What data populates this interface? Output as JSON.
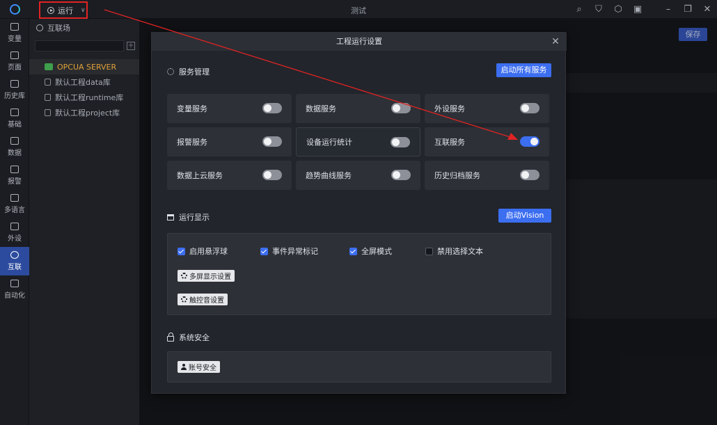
{
  "titlebar": {
    "run_label": "运行",
    "window_title": "测试",
    "icons": [
      "search-icon",
      "shield-icon",
      "package-icon",
      "save-icon",
      "minimize-icon",
      "restore-icon",
      "close-icon"
    ]
  },
  "nav": {
    "items": [
      {
        "label": "变量",
        "icon": "variable-icon"
      },
      {
        "label": "页面",
        "icon": "page-icon"
      },
      {
        "label": "历史库",
        "icon": "history-icon"
      },
      {
        "label": "基础",
        "icon": "basic-icon"
      },
      {
        "label": "数据",
        "icon": "data-icon"
      },
      {
        "label": "报警",
        "icon": "alarm-icon"
      },
      {
        "label": "多语言",
        "icon": "language-icon"
      },
      {
        "label": "外设",
        "icon": "device-icon"
      },
      {
        "label": "互联",
        "icon": "interconnect-icon",
        "active": true
      },
      {
        "label": "自动化",
        "icon": "automation-icon"
      }
    ]
  },
  "sidepanel": {
    "header": "互联场",
    "tree": [
      {
        "label": "OPCUA SERVER",
        "selected": true
      },
      {
        "label": "默认工程data库"
      },
      {
        "label": "默认工程runtime库"
      },
      {
        "label": "默认工程project库"
      }
    ]
  },
  "main": {
    "save_label": "保存"
  },
  "dialog": {
    "title": "工程运行设置",
    "service_section": {
      "title": "服务管理",
      "start_all_label": "启动所有服务",
      "services": [
        {
          "label": "变量服务",
          "on": false
        },
        {
          "label": "数据服务",
          "on": false
        },
        {
          "label": "外设服务",
          "on": false
        },
        {
          "label": "报警服务",
          "on": false
        },
        {
          "label": "设备运行统计",
          "on": false
        },
        {
          "label": "互联服务",
          "on": true
        },
        {
          "label": "数据上云服务",
          "on": false
        },
        {
          "label": "趋势曲线服务",
          "on": false
        },
        {
          "label": "历史归档服务",
          "on": false
        }
      ]
    },
    "display_section": {
      "title": "运行显示",
      "start_vision_label": "启动Vision",
      "checks": [
        {
          "label": "启用悬浮球",
          "checked": true
        },
        {
          "label": "事件异常标记",
          "checked": true
        },
        {
          "label": "全屏模式",
          "checked": true
        },
        {
          "label": "禁用选择文本",
          "checked": false
        }
      ],
      "multi_screen_label": "多屏显示设置",
      "touch_sound_label": "触控音设置"
    },
    "security_section": {
      "title": "系统安全",
      "account_label": "账号安全"
    }
  },
  "colors": {
    "accent": "#3c6ef0",
    "annotation": "#e02424",
    "selected_tree": "#e0a23a"
  }
}
